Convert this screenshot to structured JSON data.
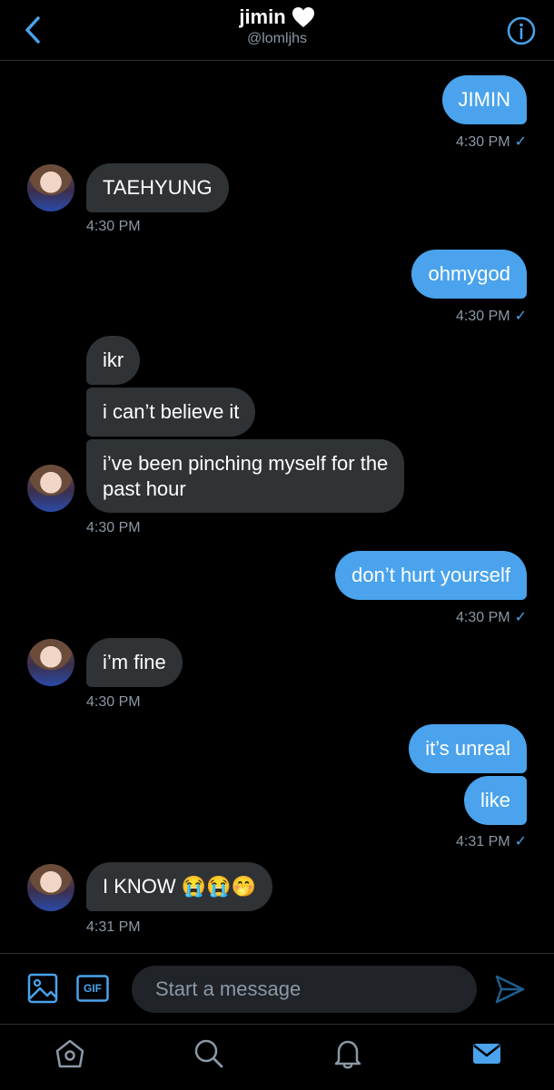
{
  "header": {
    "name": "jimin",
    "handle": "@lomljhs",
    "icons": {
      "back": "chevron-left-icon",
      "heart": "heart-icon",
      "info": "info-icon"
    }
  },
  "messages": [
    {
      "id": "m1",
      "dir": "out",
      "text": "JIMIN"
    },
    {
      "id": "m1_meta",
      "time": "4:30 PM",
      "read": "✓"
    },
    {
      "id": "m2",
      "dir": "in",
      "text": "TAEHYUNG"
    },
    {
      "id": "m2_meta",
      "time": "4:30 PM"
    },
    {
      "id": "m3",
      "dir": "out",
      "text": "ohmygod"
    },
    {
      "id": "m3_meta",
      "time": "4:30 PM",
      "read": "✓"
    },
    {
      "id": "m4",
      "dir": "in",
      "text": "ikr"
    },
    {
      "id": "m5",
      "dir": "in",
      "text": "i can’t believe it"
    },
    {
      "id": "m6",
      "dir": "in",
      "text_line1": "i’ve been pinching myself for the",
      "text_line2": "past hour"
    },
    {
      "id": "m6_meta",
      "time": "4:30 PM"
    },
    {
      "id": "m7",
      "dir": "out",
      "text": "don’t hurt yourself"
    },
    {
      "id": "m7_meta",
      "time": "4:30 PM",
      "read": "✓"
    },
    {
      "id": "m8",
      "dir": "in",
      "text": "i’m fine"
    },
    {
      "id": "m8_meta",
      "time": "4:30 PM"
    },
    {
      "id": "m9",
      "dir": "out",
      "text": "it’s unreal"
    },
    {
      "id": "m10",
      "dir": "out",
      "text": "like"
    },
    {
      "id": "m10_meta",
      "time": "4:31 PM",
      "read": "✓"
    },
    {
      "id": "m11",
      "dir": "in",
      "text": "I KNOW 😭😭🤭"
    },
    {
      "id": "m11_meta",
      "time": "4:31 PM"
    }
  ],
  "composer": {
    "placeholder": "Start a message",
    "gif_label": "GIF",
    "icons": {
      "image": "image-icon",
      "gif": "gif-icon",
      "send": "send-icon"
    }
  },
  "tabbar": {
    "icons": [
      "home-icon",
      "search-icon",
      "bell-icon",
      "mail-icon"
    ],
    "active": "mail-icon"
  },
  "colors": {
    "accent": "#4aa3ec",
    "incoming_bubble": "#2f3336",
    "muted_text": "#8b98a5",
    "background": "#000000"
  }
}
